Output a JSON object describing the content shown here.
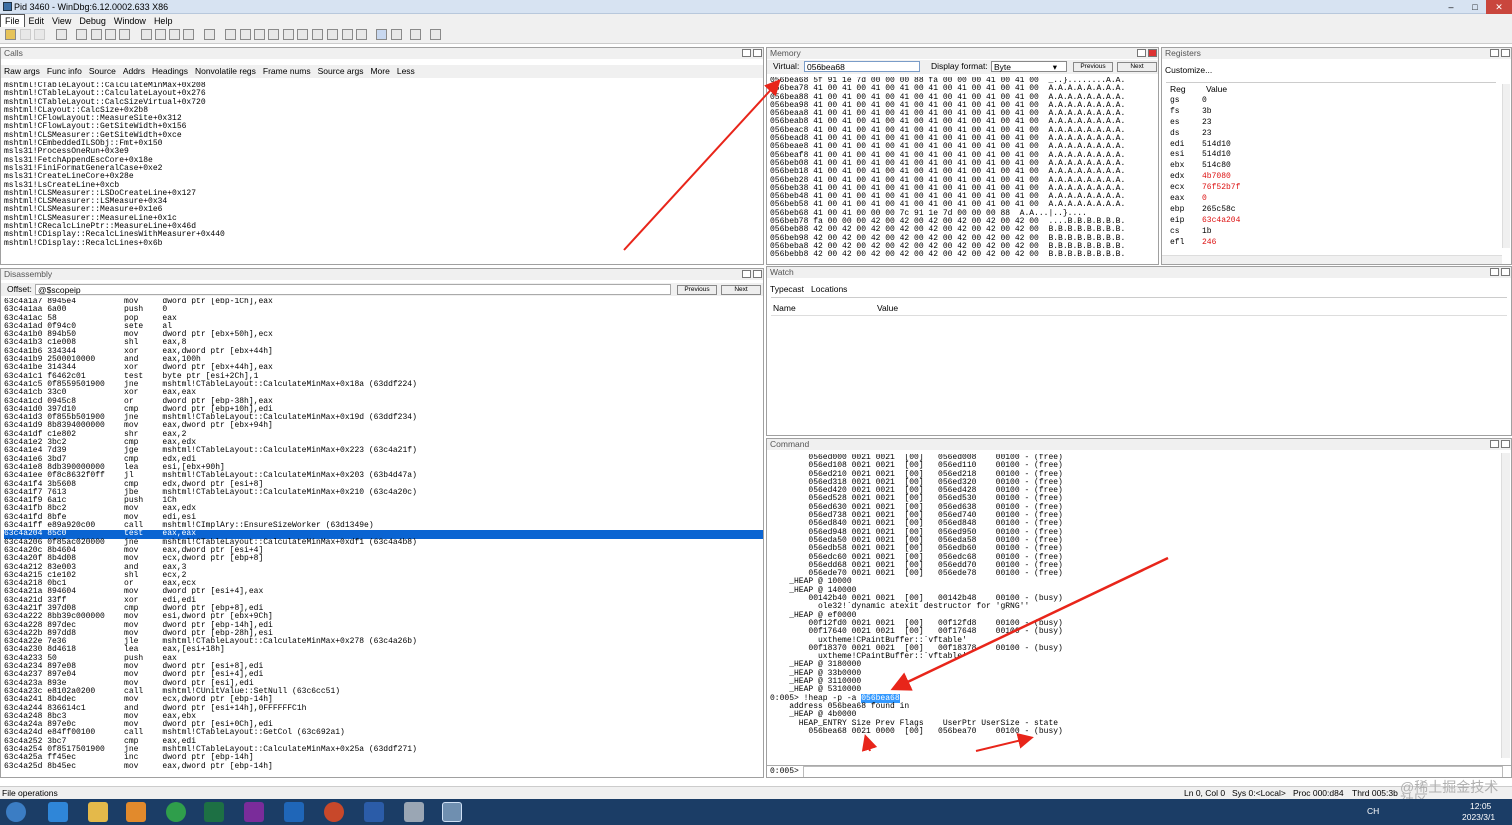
{
  "window": {
    "title": "Pid 3460 - WinDbg:6.12.0002.633 X86",
    "controls": [
      "–",
      "□",
      "✕"
    ]
  },
  "menu": [
    "File",
    "Edit",
    "View",
    "Debug",
    "Window",
    "Help"
  ],
  "calls": {
    "title": "Calls",
    "tabs": [
      "Raw args",
      "Func info",
      "Source",
      "Addrs",
      "Headings",
      "Nonvolatile regs",
      "Frame nums",
      "Source args",
      "More",
      "Less"
    ],
    "lines": [
      "mshtml!CTableLayout::CalculateMinMax+0x208",
      "mshtml!CTableLayout::CalculateLayout+0x276",
      "mshtml!CTableLayout::CalcSizeVirtual+0x720",
      "mshtml!CLayout::CalcSize+0x2b8",
      "mshtml!CFlowLayout::MeasureSite+0x312",
      "mshtml!CFlowLayout::GetSiteWidth+0x156",
      "mshtml!CLSMeasurer::GetSiteWidth+0xce",
      "mshtml!CEmbeddedILSObj::Fmt+0x150",
      "msls31!ProcessOneRun+0x3e9",
      "msls31!FetchAppendEscCore+0x18e",
      "msls31!FiniFormatGeneralCase+0xe2",
      "msls31!CreateLineCore+0x28e",
      "msls31!LsCreateLine+0xcb",
      "mshtml!CLSMeasurer::LSDoCreateLine+0x127",
      "mshtml!CLSMeasurer::LSMeasure+0x34",
      "mshtml!CLSMeasurer::Measure+0x1e6",
      "mshtml!CLSMeasurer::MeasureLine+0x1c",
      "mshtml!CRecalcLinePtr::MeasureLine+0x46d",
      "mshtml!CDisplay::RecalcLinesWithMeasurer+0x440",
      "mshtml!CDisplay::RecalcLines+0x6b"
    ]
  },
  "memory": {
    "title": "Memory",
    "virtual_label": "Virtual:",
    "virtual_value": "056bea68",
    "format_label": "Display format:",
    "format_value": "Byte",
    "prev": "Previous",
    "next": "Next",
    "lines": [
      "056bea68 5f 91 1e 7d 00 00 00 88 fa 00 00 00 41 00 41 00  _..}........A.A.",
      "056bea78 41 00 41 00 41 00 41 00 41 00 41 00 41 00 41 00  A.A.A.A.A.A.A.A.",
      "056bea88 41 00 41 00 41 00 41 00 41 00 41 00 41 00 41 00  A.A.A.A.A.A.A.A.",
      "056bea98 41 00 41 00 41 00 41 00 41 00 41 00 41 00 41 00  A.A.A.A.A.A.A.A.",
      "056beaa8 41 00 41 00 41 00 41 00 41 00 41 00 41 00 41 00  A.A.A.A.A.A.A.A.",
      "056beab8 41 00 41 00 41 00 41 00 41 00 41 00 41 00 41 00  A.A.A.A.A.A.A.A.",
      "056beac8 41 00 41 00 41 00 41 00 41 00 41 00 41 00 41 00  A.A.A.A.A.A.A.A.",
      "056bead8 41 00 41 00 41 00 41 00 41 00 41 00 41 00 41 00  A.A.A.A.A.A.A.A.",
      "056beae8 41 00 41 00 41 00 41 00 41 00 41 00 41 00 41 00  A.A.A.A.A.A.A.A.",
      "056beaf8 41 00 41 00 41 00 41 00 41 00 41 00 41 00 41 00  A.A.A.A.A.A.A.A.",
      "056beb08 41 00 41 00 41 00 41 00 41 00 41 00 41 00 41 00  A.A.A.A.A.A.A.A.",
      "056beb18 41 00 41 00 41 00 41 00 41 00 41 00 41 00 41 00  A.A.A.A.A.A.A.A.",
      "056beb28 41 00 41 00 41 00 41 00 41 00 41 00 41 00 41 00  A.A.A.A.A.A.A.A.",
      "056beb38 41 00 41 00 41 00 41 00 41 00 41 00 41 00 41 00  A.A.A.A.A.A.A.A.",
      "056beb48 41 00 41 00 41 00 41 00 41 00 41 00 41 00 41 00  A.A.A.A.A.A.A.A.",
      "056beb58 41 00 41 00 41 00 41 00 41 00 41 00 41 00 41 00  A.A.A.A.A.A.A.A.",
      "056beb68 41 00 41 00 00 00 7c 91 1e 7d 00 00 00 88  A.A...|..}....",
      "056beb78 fa 00 00 00 42 00 42 00 42 00 42 00 42 00 42 00  ....B.B.B.B.B.B.",
      "056beb88 42 00 42 00 42 00 42 00 42 00 42 00 42 00 42 00  B.B.B.B.B.B.B.B.",
      "056beb98 42 00 42 00 42 00 42 00 42 00 42 00 42 00 42 00  B.B.B.B.B.B.B.B.",
      "056beba8 42 00 42 00 42 00 42 00 42 00 42 00 42 00 42 00  B.B.B.B.B.B.B.B.",
      "056bebb8 42 00 42 00 42 00 42 00 42 00 42 00 42 00 42 00  B.B.B.B.B.B.B.B."
    ]
  },
  "registers": {
    "title": "Registers",
    "customize": "Customize...",
    "col_reg": "Reg",
    "col_value": "Value",
    "rows": [
      {
        "name": "gs",
        "value": "0",
        "changed": false
      },
      {
        "name": "fs",
        "value": "3b",
        "changed": false
      },
      {
        "name": "es",
        "value": "23",
        "changed": false
      },
      {
        "name": "ds",
        "value": "23",
        "changed": false
      },
      {
        "name": "edi",
        "value": "514d10",
        "changed": false
      },
      {
        "name": "esi",
        "value": "514d10",
        "changed": false
      },
      {
        "name": "ebx",
        "value": "514c80",
        "changed": false
      },
      {
        "name": "edx",
        "value": "4b7080",
        "changed": true
      },
      {
        "name": "ecx",
        "value": "76f52b7f",
        "changed": true
      },
      {
        "name": "eax",
        "value": "0",
        "changed": true
      },
      {
        "name": "ebp",
        "value": "265c58c",
        "changed": false
      },
      {
        "name": "eip",
        "value": "63c4a204",
        "changed": true
      },
      {
        "name": "cs",
        "value": "1b",
        "changed": false
      },
      {
        "name": "efl",
        "value": "246",
        "changed": true
      }
    ]
  },
  "disassembly": {
    "title": "Disassembly",
    "offset_label": "Offset:",
    "offset_value": "@$scopeip",
    "prev": "Previous",
    "next": "Next",
    "lines": [
      "63c4a1a7 8945e4          mov     dword ptr [ebp-1Ch],eax",
      "63c4a1aa 6a00            push    0",
      "63c4a1ac 58              pop     eax",
      "63c4a1ad 0f94c0          sete    al",
      "63c4a1b0 894b50          mov     dword ptr [ebx+50h],ecx",
      "63c4a1b3 c1e008          shl     eax,8",
      "63c4a1b6 334344          xor     eax,dword ptr [ebx+44h]",
      "63c4a1b9 2500010000      and     eax,100h",
      "63c4a1be 314344          xor     dword ptr [ebx+44h],eax",
      "63c4a1c1 f6462c01        test    byte ptr [esi+2Ch],1",
      "63c4a1c5 0f8559501900    jne     mshtml!CTableLayout::CalculateMinMax+0x18a (63ddf224)",
      "63c4a1cb 33c0            xor     eax,eax",
      "63c4a1cd 0945c8          or      dword ptr [ebp-38h],eax",
      "63c4a1d0 397d10          cmp     dword ptr [ebp+10h],edi",
      "63c4a1d3 0f855b501900    jne     mshtml!CTableLayout::CalculateMinMax+0x19d (63ddf234)",
      "63c4a1d9 8b8394000000    mov     eax,dword ptr [ebx+94h]",
      "63c4a1df c1e802          shr     eax,2",
      "63c4a1e2 3bc2            cmp     eax,edx",
      "63c4a1e4 7d39            jge     mshtml!CTableLayout::CalculateMinMax+0x223 (63c4a21f)",
      "63c4a1e6 3bd7            cmp     edx,edi",
      "63c4a1e8 8db390000000    lea     esi,[ebx+90h]",
      "63c4a1ee 0f8c8632f0ff    jl      mshtml!CTableLayout::CalculateMinMax+0x203 (63b4d47a)",
      "63c4a1f4 3b5608          cmp     edx,dword ptr [esi+8]",
      "63c4a1f7 7613            jbe     mshtml!CTableLayout::CalculateMinMax+0x210 (63c4a20c)",
      "63c4a1f9 6a1c            push    1Ch",
      "63c4a1fb 8bc2            mov     eax,edx",
      "63c4a1fd 8bfe            mov     edi,esi",
      "63c4a1ff e89a920c00      call    mshtml!CImplAry::EnsureSizeWorker (63d1349e)",
      "63c4a204 85c0            test    eax,eax",
      "63c4a206 0f85ac020000    jne     mshtml!CTableLayout::CalculateMinMax+0xdf1 (63c4a4b8)",
      "63c4a20c 8b4604          mov     eax,dword ptr [esi+4]",
      "63c4a20f 8b4d08          mov     ecx,dword ptr [ebp+8]",
      "63c4a212 83e003          and     eax,3",
      "63c4a215 c1e102          shl     ecx,2",
      "63c4a218 0bc1            or      eax,ecx",
      "63c4a21a 894604          mov     dword ptr [esi+4],eax",
      "63c4a21d 33ff            xor     edi,edi",
      "63c4a21f 397d08          cmp     dword ptr [ebp+8],edi",
      "63c4a222 8bb39c000000    mov     esi,dword ptr [ebx+9Ch]",
      "63c4a228 897dec          mov     dword ptr [ebp-14h],edi",
      "63c4a22b 897dd8          mov     dword ptr [ebp-28h],esi",
      "63c4a22e 7e36            jle     mshtml!CTableLayout::CalculateMinMax+0x278 (63c4a26b)",
      "63c4a230 8d4618          lea     eax,[esi+18h]",
      "63c4a233 50              push    eax",
      "63c4a234 897e08          mov     dword ptr [esi+8],edi",
      "63c4a237 897e04          mov     dword ptr [esi+4],edi",
      "63c4a23a 893e            mov     dword ptr [esi],edi",
      "63c4a23c e8102a0200      call    mshtml!CUnitValue::SetNull (63c6cc51)",
      "63c4a241 8b4dec          mov     ecx,dword ptr [ebp-14h]",
      "63c4a244 836614c1        and     dword ptr [esi+14h],0FFFFFFC1h",
      "63c4a248 8bc3            mov     eax,ebx",
      "63c4a24a 897e0c          mov     dword ptr [esi+0Ch],edi",
      "63c4a24d e84ff00100      call    mshtml!CTableLayout::GetCol (63c692a1)",
      "63c4a252 3bc7            cmp     eax,edi",
      "63c4a254 0f8517501900    jne     mshtml!CTableLayout::CalculateMinMax+0x25a (63ddf271)",
      "63c4a25a ff45ec          inc     dword ptr [ebp-14h]",
      "63c4a25d 8b45ec          mov     eax,dword ptr [ebp-14h]"
    ],
    "current_index": 28
  },
  "watch": {
    "title": "Watch",
    "tabs": [
      "Typecast",
      "Locations"
    ],
    "col_name": "Name",
    "col_value": "Value"
  },
  "command": {
    "title": "Command",
    "lines": [
      "        056ed000 0021 0021  [00]   056ed008    00100 - (free)",
      "        056ed108 0021 0021  [00]   056ed110    00100 - (free)",
      "        056ed210 0021 0021  [00]   056ed218    00100 - (free)",
      "        056ed318 0021 0021  [00]   056ed320    00100 - (free)",
      "        056ed420 0021 0021  [00]   056ed428    00100 - (free)",
      "        056ed528 0021 0021  [00]   056ed530    00100 - (free)",
      "        056ed630 0021 0021  [00]   056ed638    00100 - (free)",
      "        056ed738 0021 0021  [00]   056ed740    00100 - (free)",
      "        056ed840 0021 0021  [00]   056ed848    00100 - (free)",
      "        056ed948 0021 0021  [00]   056ed950    00100 - (free)",
      "        056eda50 0021 0021  [00]   056eda58    00100 - (free)",
      "        056edb58 0021 0021  [00]   056edb60    00100 - (free)",
      "        056edc60 0021 0021  [00]   056edc68    00100 - (free)",
      "        056edd68 0021 0021  [00]   056edd70    00100 - (free)",
      "        056ede70 0021 0021  [00]   056ede78    00100 - (free)",
      "    _HEAP @ 10000",
      "    _HEAP @ 140000",
      "        00142b40 0021 0021  [00]   00142b48    00100 - (busy)",
      "          ole32!`dynamic atexit destructor for 'gRNG''",
      "    _HEAP @ ef0000",
      "        00f12fd0 0021 0021  [00]   00f12fd8    00100 - (busy)",
      "        00f17640 0021 0021  [00]   00f17648    00100 - (busy)",
      "          uxtheme!CPaintBuffer::`vftable'",
      "        00f18370 0021 0021  [00]   00f18378    00100 - (busy)",
      "          uxtheme!CPaintBuffer::`vftable'",
      "    _HEAP @ 3180000",
      "    _HEAP @ 33b0000",
      "    _HEAP @ 3110000",
      "    _HEAP @ 5310000"
    ],
    "cmd_prompt": "0:005> !heap -p -a ",
    "cmd_arg": "056bea68",
    "result_lines": [
      "    address 056bea68 found in",
      "    _HEAP @ 4b0000",
      "      HEAP_ENTRY Size Prev Flags    UserPtr UserSize - state",
      "        056bea68 0021 0000  [00]   056bea70    00100 - (busy)"
    ],
    "input_prompt": "0:005>"
  },
  "status": {
    "left": "File operations",
    "position": "Ln 0, Col 0",
    "sys": "Sys 0:<Local>",
    "proc": "Proc 000:d84",
    "thrd": "Thrd 005:3b",
    "watermark": "@稀土掘金技术社区"
  },
  "taskbar": {
    "time": "12:05",
    "date": "2023/3/1",
    "tray": "CH"
  },
  "colors": {
    "accent": "#0a64d2",
    "arrow": "#e8251a",
    "changed_reg": "#d11111"
  }
}
